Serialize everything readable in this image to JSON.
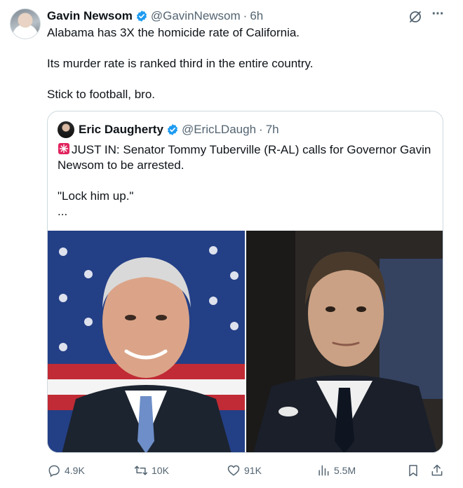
{
  "tweet": {
    "author_name": "Gavin Newsom",
    "handle": "@GavinNewsom",
    "separator": "·",
    "time": "6h",
    "lines": [
      "Alabama has 3X the homicide rate of California.",
      "Its murder rate is ranked third in the entire country.",
      "Stick to football, bro."
    ]
  },
  "quote": {
    "author_name": "Eric Daugherty",
    "handle": "@EricLDaugh",
    "separator": "·",
    "time": "7h",
    "text_main": "JUST IN: Senator Tommy Tuberville (R-AL) calls for Governor Gavin Newsom to be arrested.",
    "text_quote": "\"Lock him up.\"",
    "text_more": "...",
    "emoji": "rotating-light-icon"
  },
  "actions": {
    "replies": "4.9K",
    "reposts": "10K",
    "likes": "91K",
    "views": "5.5M"
  },
  "icons": {
    "verified": "verified-badge-icon",
    "grok": "grok-icon",
    "more": "more-icon",
    "reply": "reply-icon",
    "repost": "repost-icon",
    "like": "like-icon",
    "views": "views-icon",
    "bookmark": "bookmark-icon",
    "share": "share-icon"
  },
  "colors": {
    "text": "#0f1419",
    "secondary": "#536471",
    "verified": "#1d9bf0",
    "border": "#cfd9de"
  }
}
